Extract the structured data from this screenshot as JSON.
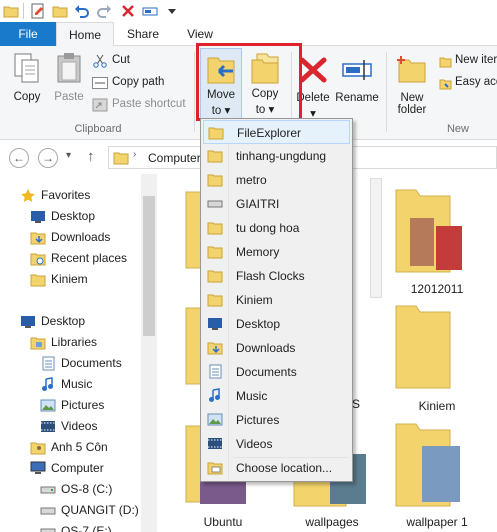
{
  "ribbon_tabs": {
    "file": "File",
    "home": "Home",
    "share": "Share",
    "view": "View"
  },
  "clipboard": {
    "copy": "Copy",
    "paste": "Paste",
    "cut": "Cut",
    "copy_path": "Copy path",
    "paste_shortcut": "Paste shortcut",
    "group_label": "Clipboard"
  },
  "organize": {
    "move_to": "Move",
    "move_to_2": "to",
    "copy_to": "Copy",
    "copy_to_2": "to",
    "delete": "Delete",
    "rename": "Rename"
  },
  "new_group": {
    "new_folder": "New",
    "new_folder_2": "folder",
    "new_item": "New iter",
    "easy_access": "Easy acc",
    "group_label": "New"
  },
  "address": {
    "path": "Computer"
  },
  "nav": {
    "items": [
      {
        "label": "Favorites",
        "icon": "star-icon"
      },
      {
        "label": "Desktop",
        "icon": "desktop-icon"
      },
      {
        "label": "Downloads",
        "icon": "downloads-icon"
      },
      {
        "label": "Recent places",
        "icon": "recent-places-icon"
      },
      {
        "label": "Kiniem",
        "icon": "folder-icon"
      },
      {
        "label": "Desktop",
        "icon": "desktop-icon"
      },
      {
        "label": "Libraries",
        "icon": "libraries-icon"
      },
      {
        "label": "Documents",
        "icon": "documents-icon"
      },
      {
        "label": "Music",
        "icon": "music-icon"
      },
      {
        "label": "Pictures",
        "icon": "pictures-icon"
      },
      {
        "label": "Videos",
        "icon": "videos-icon"
      },
      {
        "label": "Anh 5 Côn",
        "icon": "user-folder-icon"
      },
      {
        "label": "Computer",
        "icon": "computer-icon"
      },
      {
        "label": "OS-8 (C:)",
        "icon": "drive-icon"
      },
      {
        "label": "QUANGIT (D:)",
        "icon": "drive-icon"
      },
      {
        "label": "OS-7 (E:)",
        "icon": "drive-icon"
      }
    ]
  },
  "content": {
    "captions": [
      "12012011",
      "Kiniem",
      "Ubuntu",
      "wallpages",
      "wallpaper 1",
      "S"
    ]
  },
  "move_menu": {
    "items": [
      {
        "label": "FileExplorer",
        "icon": "folder-icon"
      },
      {
        "label": "tinhang-ungdung",
        "icon": "folder-icon"
      },
      {
        "label": "metro",
        "icon": "folder-icon"
      },
      {
        "label": "GIAITRI",
        "icon": "drive-icon"
      },
      {
        "label": "tu dong hoa",
        "icon": "folder-icon"
      },
      {
        "label": "Memory",
        "icon": "folder-icon"
      },
      {
        "label": "Flash Clocks",
        "icon": "folder-icon"
      },
      {
        "label": "Kiniem",
        "icon": "folder-icon"
      },
      {
        "label": "Desktop",
        "icon": "desktop-icon"
      },
      {
        "label": "Downloads",
        "icon": "downloads-icon"
      },
      {
        "label": "Documents",
        "icon": "documents-icon"
      },
      {
        "label": "Music",
        "icon": "music-icon"
      },
      {
        "label": "Pictures",
        "icon": "pictures-icon"
      },
      {
        "label": "Videos",
        "icon": "videos-icon"
      },
      {
        "label": "Choose location...",
        "icon": "choose-location-icon"
      }
    ]
  },
  "colors": {
    "file_tab": "#1979ca",
    "highlight_box": "#e0202a",
    "folder_yellow": "#f3d46c"
  }
}
